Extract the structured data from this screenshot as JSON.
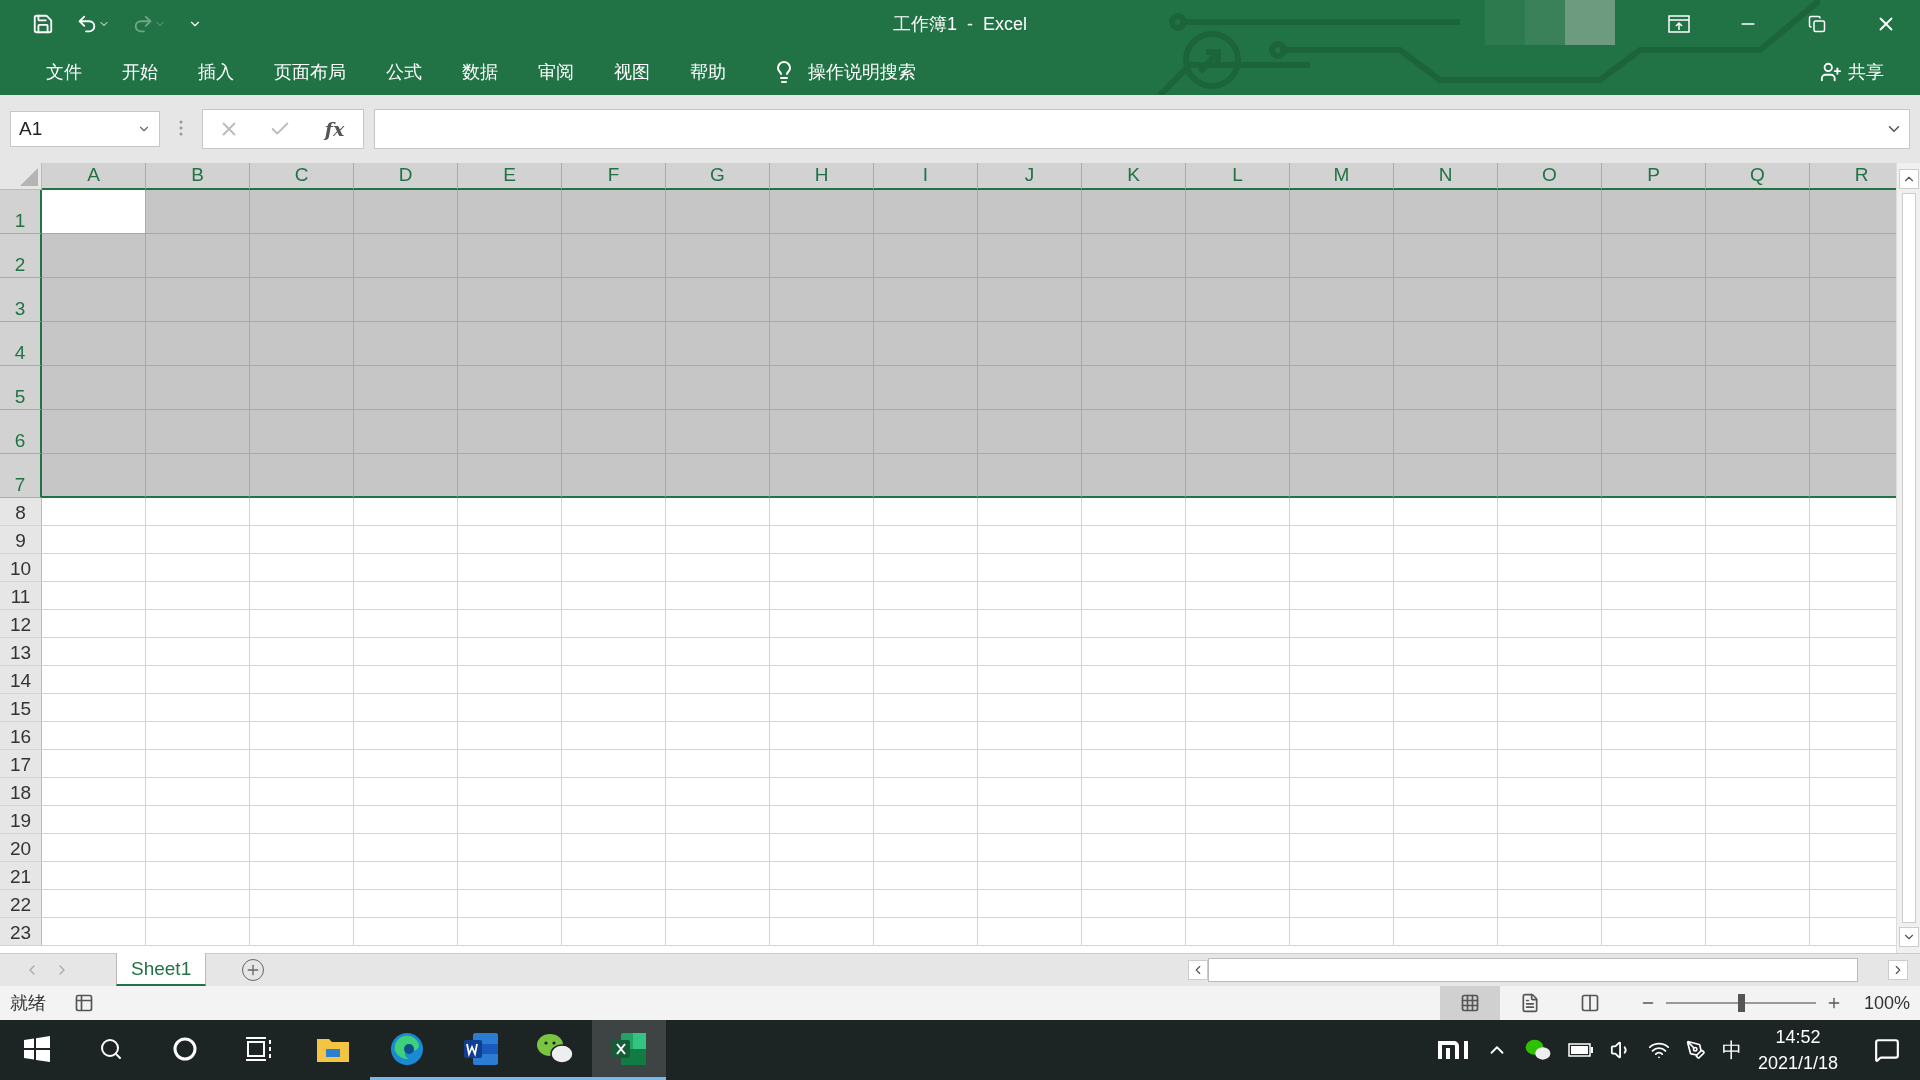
{
  "window": {
    "title": "工作簿1  -  Excel"
  },
  "ribbon_tabs": [
    {
      "label": "文件"
    },
    {
      "label": "开始"
    },
    {
      "label": "插入"
    },
    {
      "label": "页面布局"
    },
    {
      "label": "公式"
    },
    {
      "label": "数据"
    },
    {
      "label": "审阅"
    },
    {
      "label": "视图"
    },
    {
      "label": "帮助"
    }
  ],
  "tell_me": {
    "label": "操作说明搜索"
  },
  "share": {
    "label": "共享"
  },
  "formula_bar": {
    "name_box": "A1",
    "function_label": "fx"
  },
  "columns": [
    {
      "label": "A",
      "active": true
    },
    {
      "label": "B",
      "active": false
    },
    {
      "label": "C",
      "active": false
    },
    {
      "label": "D",
      "active": false
    },
    {
      "label": "E",
      "active": false
    },
    {
      "label": "F",
      "active": false
    },
    {
      "label": "G",
      "active": false
    },
    {
      "label": "H",
      "active": false
    },
    {
      "label": "I",
      "active": false
    },
    {
      "label": "J",
      "active": false
    },
    {
      "label": "K",
      "active": false
    },
    {
      "label": "L",
      "active": false
    },
    {
      "label": "M",
      "active": false
    },
    {
      "label": "N",
      "active": false
    },
    {
      "label": "O",
      "active": false
    },
    {
      "label": "P",
      "active": false
    },
    {
      "label": "Q",
      "active": false
    },
    {
      "label": "R",
      "active": false
    }
  ],
  "rows": [
    {
      "label": "1",
      "selected": true,
      "active": true
    },
    {
      "label": "2",
      "selected": true,
      "active": false
    },
    {
      "label": "3",
      "selected": true,
      "active": false
    },
    {
      "label": "4",
      "selected": true,
      "active": false
    },
    {
      "label": "5",
      "selected": true,
      "active": false
    },
    {
      "label": "6",
      "selected": true,
      "active": false
    },
    {
      "label": "7",
      "selected": true,
      "active": false
    },
    {
      "label": "8",
      "selected": false,
      "active": false
    },
    {
      "label": "9",
      "selected": false,
      "active": false
    },
    {
      "label": "10",
      "selected": false,
      "active": false
    },
    {
      "label": "11",
      "selected": false,
      "active": false
    },
    {
      "label": "12",
      "selected": false,
      "active": false
    },
    {
      "label": "13",
      "selected": false,
      "active": false
    },
    {
      "label": "14",
      "selected": false,
      "active": false
    },
    {
      "label": "15",
      "selected": false,
      "active": false
    },
    {
      "label": "16",
      "selected": false,
      "active": false
    },
    {
      "label": "17",
      "selected": false,
      "active": false
    },
    {
      "label": "18",
      "selected": false,
      "active": false
    },
    {
      "label": "19",
      "selected": false,
      "active": false
    },
    {
      "label": "20",
      "selected": false,
      "active": false
    },
    {
      "label": "21",
      "selected": false,
      "active": false
    },
    {
      "label": "22",
      "selected": false,
      "active": false
    },
    {
      "label": "23",
      "selected": false,
      "active": false
    }
  ],
  "sheet_tabs": [
    {
      "label": "Sheet1",
      "selected": true
    }
  ],
  "status_bar": {
    "status": "就绪",
    "zoom": "100%",
    "zoom_slider": {
      "level": 0.5
    },
    "views": [
      {
        "kind": "normal",
        "selected": true
      },
      {
        "kind": "page-layout",
        "selected": false
      },
      {
        "kind": "page-break",
        "selected": false
      }
    ]
  },
  "taskbar": {
    "apps": [
      {
        "kind": "explorer",
        "running": false,
        "selected": false
      },
      {
        "kind": "edge",
        "running": true,
        "selected": false
      },
      {
        "kind": "word",
        "running": true,
        "selected": false
      },
      {
        "kind": "wechat",
        "running": true,
        "selected": false
      },
      {
        "kind": "excel",
        "running": true,
        "selected": true
      }
    ],
    "ime": "中",
    "time": "14:52",
    "date": "2021/1/18"
  }
}
